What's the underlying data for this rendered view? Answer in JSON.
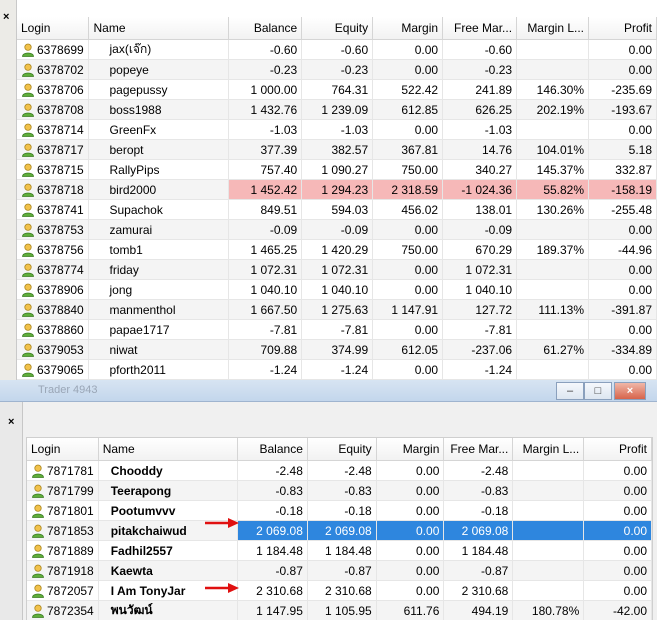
{
  "colors": {
    "warn_row": "#f6b8b8",
    "selected_row": "#2e86de",
    "arrow": "#e01010"
  },
  "top_panel": {
    "close_glyph": "×",
    "columns": [
      "Login",
      "Name",
      "Balance",
      "Equity",
      "Margin",
      "Free Mar...",
      "Margin L...",
      "Profit"
    ],
    "rows": [
      {
        "login": "6378699",
        "name": "jax(เจ๊ก)",
        "balance": "-0.60",
        "equity": "-0.60",
        "margin": "0.00",
        "free": "-0.60",
        "level": "",
        "profit": "0.00"
      },
      {
        "login": "6378702",
        "name": "popeye",
        "balance": "-0.23",
        "equity": "-0.23",
        "margin": "0.00",
        "free": "-0.23",
        "level": "",
        "profit": "0.00"
      },
      {
        "login": "6378706",
        "name": "pagepussy",
        "balance": "1 000.00",
        "equity": "764.31",
        "margin": "522.42",
        "free": "241.89",
        "level": "146.30%",
        "profit": "-235.69"
      },
      {
        "login": "6378708",
        "name": "boss1988",
        "balance": "1 432.76",
        "equity": "1 239.09",
        "margin": "612.85",
        "free": "626.25",
        "level": "202.19%",
        "profit": "-193.67"
      },
      {
        "login": "6378714",
        "name": "GreenFx",
        "balance": "-1.03",
        "equity": "-1.03",
        "margin": "0.00",
        "free": "-1.03",
        "level": "",
        "profit": "0.00"
      },
      {
        "login": "6378717",
        "name": "beropt",
        "balance": "377.39",
        "equity": "382.57",
        "margin": "367.81",
        "free": "14.76",
        "level": "104.01%",
        "profit": "5.18"
      },
      {
        "login": "6378715",
        "name": "RallyPips",
        "balance": "757.40",
        "equity": "1 090.27",
        "margin": "750.00",
        "free": "340.27",
        "level": "145.37%",
        "profit": "332.87"
      },
      {
        "login": "6378718",
        "name": "bird2000",
        "balance": "1 452.42",
        "equity": "1 294.23",
        "margin": "2 318.59",
        "free": "-1 024.36",
        "level": "55.82%",
        "profit": "-158.19",
        "state": "warn"
      },
      {
        "login": "6378741",
        "name": "Supachok",
        "balance": "849.51",
        "equity": "594.03",
        "margin": "456.02",
        "free": "138.01",
        "level": "130.26%",
        "profit": "-255.48"
      },
      {
        "login": "6378753",
        "name": "zamurai",
        "balance": "-0.09",
        "equity": "-0.09",
        "margin": "0.00",
        "free": "-0.09",
        "level": "",
        "profit": "0.00"
      },
      {
        "login": "6378756",
        "name": "tomb1",
        "balance": "1 465.25",
        "equity": "1 420.29",
        "margin": "750.00",
        "free": "670.29",
        "level": "189.37%",
        "profit": "-44.96"
      },
      {
        "login": "6378774",
        "name": "friday",
        "balance": "1 072.31",
        "equity": "1 072.31",
        "margin": "0.00",
        "free": "1 072.31",
        "level": "",
        "profit": "0.00"
      },
      {
        "login": "6378906",
        "name": "jong",
        "balance": "1 040.10",
        "equity": "1 040.10",
        "margin": "0.00",
        "free": "1 040.10",
        "level": "",
        "profit": "0.00"
      },
      {
        "login": "6378840",
        "name": "manmenthol",
        "balance": "1 667.50",
        "equity": "1 275.63",
        "margin": "1 147.91",
        "free": "127.72",
        "level": "111.13%",
        "profit": "-391.87"
      },
      {
        "login": "6378860",
        "name": "papae1717",
        "balance": "-7.81",
        "equity": "-7.81",
        "margin": "0.00",
        "free": "-7.81",
        "level": "",
        "profit": "0.00"
      },
      {
        "login": "6379053",
        "name": "niwat",
        "balance": "709.88",
        "equity": "374.99",
        "margin": "612.05",
        "free": "-237.06",
        "level": "61.27%",
        "profit": "-334.89"
      },
      {
        "login": "6379065",
        "name": "pforth2011",
        "balance": "-1.24",
        "equity": "-1.24",
        "margin": "0.00",
        "free": "-1.24",
        "level": "",
        "profit": "0.00"
      }
    ]
  },
  "bottom_window": {
    "title": "Trader 4943",
    "buttons": {
      "minimize": "–",
      "maximize": "□",
      "close": "×"
    },
    "close_glyph": "×",
    "columns": [
      "Login",
      "Name",
      "Balance",
      "Equity",
      "Margin",
      "Free Mar...",
      "Margin L...",
      "Profit"
    ],
    "rows": [
      {
        "login": "7871781",
        "name": "Chooddy",
        "balance": "-2.48",
        "equity": "-2.48",
        "margin": "0.00",
        "free": "-2.48",
        "level": "",
        "profit": "0.00"
      },
      {
        "login": "7871799",
        "name": "Teerapong",
        "balance": "-0.83",
        "equity": "-0.83",
        "margin": "0.00",
        "free": "-0.83",
        "level": "",
        "profit": "0.00"
      },
      {
        "login": "7871801",
        "name": "Pootumvvv",
        "balance": "-0.18",
        "equity": "-0.18",
        "margin": "0.00",
        "free": "-0.18",
        "level": "",
        "profit": "0.00"
      },
      {
        "login": "7871853",
        "name": "pitakchaiwud",
        "balance": "2 069.08",
        "equity": "2 069.08",
        "margin": "0.00",
        "free": "2 069.08",
        "level": "",
        "profit": "0.00",
        "state": "sel"
      },
      {
        "login": "7871889",
        "name": "Fadhil2557",
        "balance": "1 184.48",
        "equity": "1 184.48",
        "margin": "0.00",
        "free": "1 184.48",
        "level": "",
        "profit": "0.00"
      },
      {
        "login": "7871918",
        "name": "Kaewta",
        "balance": "-0.87",
        "equity": "-0.87",
        "margin": "0.00",
        "free": "-0.87",
        "level": "",
        "profit": "0.00"
      },
      {
        "login": "7872057",
        "name": "I Am TonyJar",
        "balance": "2 310.68",
        "equity": "2 310.68",
        "margin": "0.00",
        "free": "2 310.68",
        "level": "",
        "profit": "0.00"
      },
      {
        "login": "7872354",
        "name": "พนวัฒน์",
        "balance": "1 147.95",
        "equity": "1 105.95",
        "margin": "611.76",
        "free": "494.19",
        "level": "180.78%",
        "profit": "-42.00"
      }
    ]
  }
}
